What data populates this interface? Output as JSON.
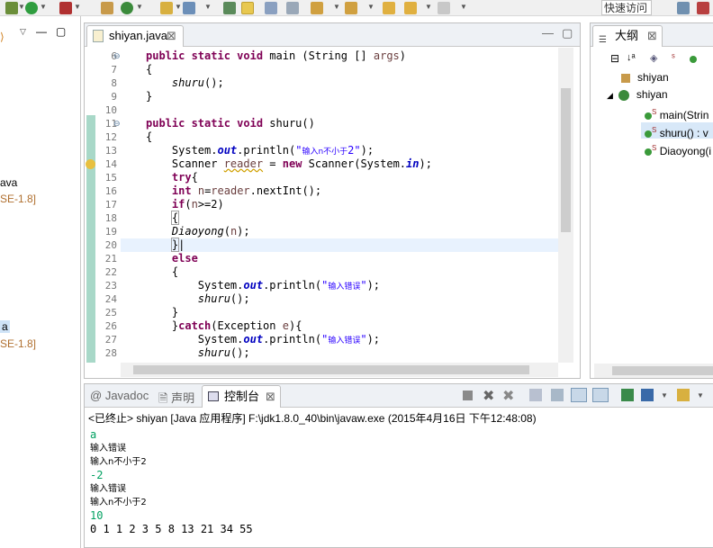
{
  "toolbar": {
    "quick_access_placeholder": "快速访问"
  },
  "package_explorer": {
    "label_1": "ava",
    "label_2": "SE-1.8]",
    "label_3": "a",
    "label_4": "SE-1.8]"
  },
  "editor": {
    "tab_label": "shiyan.java",
    "lines": [
      {
        "n": "6",
        "fold": "⊖"
      },
      {
        "n": "7"
      },
      {
        "n": "8"
      },
      {
        "n": "9"
      },
      {
        "n": "10"
      },
      {
        "n": "11",
        "fold": "⊖"
      },
      {
        "n": "12"
      },
      {
        "n": "13"
      },
      {
        "n": "14"
      },
      {
        "n": "15"
      },
      {
        "n": "16"
      },
      {
        "n": "17"
      },
      {
        "n": "18"
      },
      {
        "n": "19"
      },
      {
        "n": "20"
      },
      {
        "n": "21"
      },
      {
        "n": "22"
      },
      {
        "n": "23"
      },
      {
        "n": "24"
      },
      {
        "n": "25"
      },
      {
        "n": "26"
      },
      {
        "n": "27"
      },
      {
        "n": "28"
      }
    ]
  },
  "outline": {
    "tab_label": "大纲",
    "items": [
      {
        "label": "shiyan"
      },
      {
        "label": "shiyan"
      },
      {
        "label": "main(Strin"
      },
      {
        "label": "shuru() : v"
      },
      {
        "label": "Diaoyong(i"
      }
    ]
  },
  "console": {
    "tabs": {
      "javadoc": "Javadoc",
      "declaration": "声明",
      "console": "控制台"
    },
    "status": "<已终止> shiyan [Java 应用程序] F:\\jdk1.8.0_40\\bin\\javaw.exe (2015年4月16日 下午12:48:08)",
    "output": [
      {
        "text": "a",
        "kind": "input"
      },
      {
        "text": "输入错误",
        "kind": "out"
      },
      {
        "text": "输入n不小于2",
        "kind": "out"
      },
      {
        "text": "-2",
        "kind": "input"
      },
      {
        "text": "输入错误",
        "kind": "out"
      },
      {
        "text": "输入n不小于2",
        "kind": "out"
      },
      {
        "text": "10",
        "kind": "input"
      },
      {
        "text": "0 1 1 2 3 5 8 13 21 34 55",
        "kind": "mono"
      }
    ]
  },
  "colors": {
    "keyword": "#7f0055",
    "string": "#2a00ff",
    "field": "#0000c0",
    "input": "#00a060",
    "current_line": "#e8f2fe"
  }
}
